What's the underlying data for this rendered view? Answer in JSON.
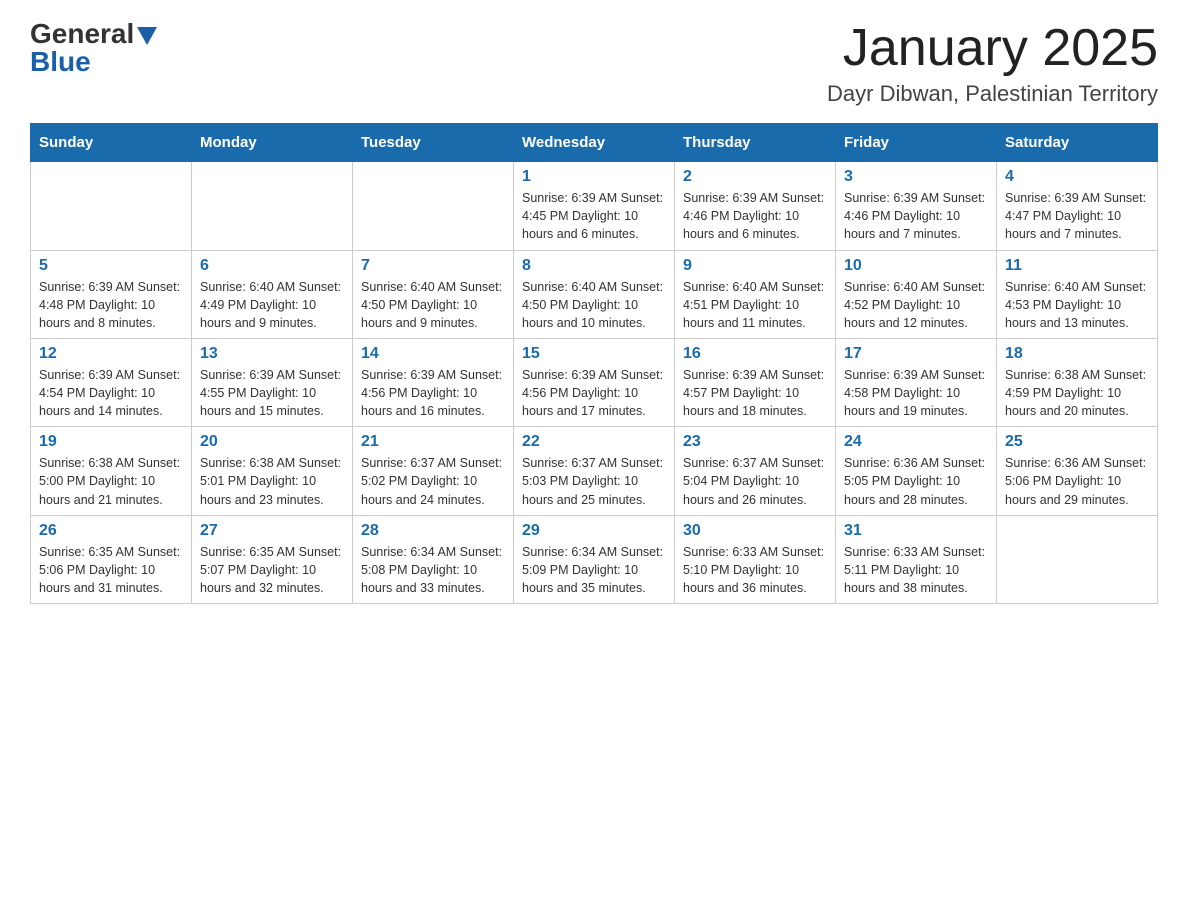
{
  "header": {
    "logo_general": "General",
    "logo_blue": "Blue",
    "month_title": "January 2025",
    "location": "Dayr Dibwan, Palestinian Territory"
  },
  "days_of_week": [
    "Sunday",
    "Monday",
    "Tuesday",
    "Wednesday",
    "Thursday",
    "Friday",
    "Saturday"
  ],
  "weeks": [
    [
      {
        "day": "",
        "info": ""
      },
      {
        "day": "",
        "info": ""
      },
      {
        "day": "",
        "info": ""
      },
      {
        "day": "1",
        "info": "Sunrise: 6:39 AM\nSunset: 4:45 PM\nDaylight: 10 hours and 6 minutes."
      },
      {
        "day": "2",
        "info": "Sunrise: 6:39 AM\nSunset: 4:46 PM\nDaylight: 10 hours and 6 minutes."
      },
      {
        "day": "3",
        "info": "Sunrise: 6:39 AM\nSunset: 4:46 PM\nDaylight: 10 hours and 7 minutes."
      },
      {
        "day": "4",
        "info": "Sunrise: 6:39 AM\nSunset: 4:47 PM\nDaylight: 10 hours and 7 minutes."
      }
    ],
    [
      {
        "day": "5",
        "info": "Sunrise: 6:39 AM\nSunset: 4:48 PM\nDaylight: 10 hours and 8 minutes."
      },
      {
        "day": "6",
        "info": "Sunrise: 6:40 AM\nSunset: 4:49 PM\nDaylight: 10 hours and 9 minutes."
      },
      {
        "day": "7",
        "info": "Sunrise: 6:40 AM\nSunset: 4:50 PM\nDaylight: 10 hours and 9 minutes."
      },
      {
        "day": "8",
        "info": "Sunrise: 6:40 AM\nSunset: 4:50 PM\nDaylight: 10 hours and 10 minutes."
      },
      {
        "day": "9",
        "info": "Sunrise: 6:40 AM\nSunset: 4:51 PM\nDaylight: 10 hours and 11 minutes."
      },
      {
        "day": "10",
        "info": "Sunrise: 6:40 AM\nSunset: 4:52 PM\nDaylight: 10 hours and 12 minutes."
      },
      {
        "day": "11",
        "info": "Sunrise: 6:40 AM\nSunset: 4:53 PM\nDaylight: 10 hours and 13 minutes."
      }
    ],
    [
      {
        "day": "12",
        "info": "Sunrise: 6:39 AM\nSunset: 4:54 PM\nDaylight: 10 hours and 14 minutes."
      },
      {
        "day": "13",
        "info": "Sunrise: 6:39 AM\nSunset: 4:55 PM\nDaylight: 10 hours and 15 minutes."
      },
      {
        "day": "14",
        "info": "Sunrise: 6:39 AM\nSunset: 4:56 PM\nDaylight: 10 hours and 16 minutes."
      },
      {
        "day": "15",
        "info": "Sunrise: 6:39 AM\nSunset: 4:56 PM\nDaylight: 10 hours and 17 minutes."
      },
      {
        "day": "16",
        "info": "Sunrise: 6:39 AM\nSunset: 4:57 PM\nDaylight: 10 hours and 18 minutes."
      },
      {
        "day": "17",
        "info": "Sunrise: 6:39 AM\nSunset: 4:58 PM\nDaylight: 10 hours and 19 minutes."
      },
      {
        "day": "18",
        "info": "Sunrise: 6:38 AM\nSunset: 4:59 PM\nDaylight: 10 hours and 20 minutes."
      }
    ],
    [
      {
        "day": "19",
        "info": "Sunrise: 6:38 AM\nSunset: 5:00 PM\nDaylight: 10 hours and 21 minutes."
      },
      {
        "day": "20",
        "info": "Sunrise: 6:38 AM\nSunset: 5:01 PM\nDaylight: 10 hours and 23 minutes."
      },
      {
        "day": "21",
        "info": "Sunrise: 6:37 AM\nSunset: 5:02 PM\nDaylight: 10 hours and 24 minutes."
      },
      {
        "day": "22",
        "info": "Sunrise: 6:37 AM\nSunset: 5:03 PM\nDaylight: 10 hours and 25 minutes."
      },
      {
        "day": "23",
        "info": "Sunrise: 6:37 AM\nSunset: 5:04 PM\nDaylight: 10 hours and 26 minutes."
      },
      {
        "day": "24",
        "info": "Sunrise: 6:36 AM\nSunset: 5:05 PM\nDaylight: 10 hours and 28 minutes."
      },
      {
        "day": "25",
        "info": "Sunrise: 6:36 AM\nSunset: 5:06 PM\nDaylight: 10 hours and 29 minutes."
      }
    ],
    [
      {
        "day": "26",
        "info": "Sunrise: 6:35 AM\nSunset: 5:06 PM\nDaylight: 10 hours and 31 minutes."
      },
      {
        "day": "27",
        "info": "Sunrise: 6:35 AM\nSunset: 5:07 PM\nDaylight: 10 hours and 32 minutes."
      },
      {
        "day": "28",
        "info": "Sunrise: 6:34 AM\nSunset: 5:08 PM\nDaylight: 10 hours and 33 minutes."
      },
      {
        "day": "29",
        "info": "Sunrise: 6:34 AM\nSunset: 5:09 PM\nDaylight: 10 hours and 35 minutes."
      },
      {
        "day": "30",
        "info": "Sunrise: 6:33 AM\nSunset: 5:10 PM\nDaylight: 10 hours and 36 minutes."
      },
      {
        "day": "31",
        "info": "Sunrise: 6:33 AM\nSunset: 5:11 PM\nDaylight: 10 hours and 38 minutes."
      },
      {
        "day": "",
        "info": ""
      }
    ]
  ]
}
